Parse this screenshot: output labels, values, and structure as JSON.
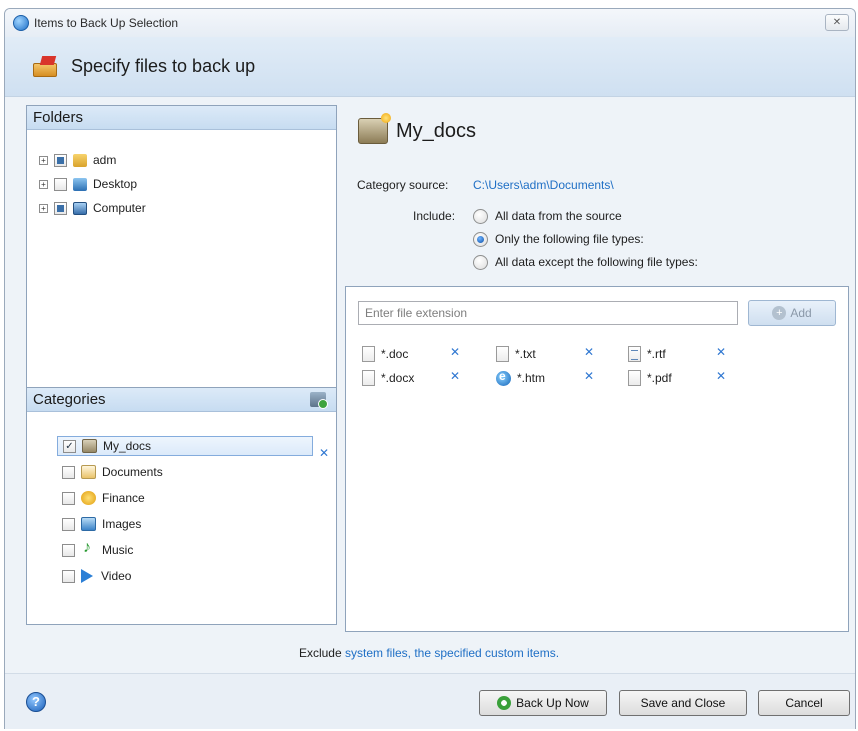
{
  "window": {
    "title": "Items to Back Up Selection",
    "close_glyph": "✕"
  },
  "header": {
    "title": "Specify files to back up"
  },
  "folders": {
    "heading": "Folders",
    "items": [
      {
        "label": "adm",
        "checked": "partial",
        "icon": "user-folder-icon"
      },
      {
        "label": "Desktop",
        "checked": "none",
        "icon": "desktop-icon"
      },
      {
        "label": "Computer",
        "checked": "partial",
        "icon": "computer-icon"
      }
    ]
  },
  "categories": {
    "heading": "Categories",
    "items": [
      {
        "label": "My_docs",
        "checked": true,
        "selected": true
      },
      {
        "label": "Documents",
        "checked": false
      },
      {
        "label": "Finance",
        "checked": false
      },
      {
        "label": "Images",
        "checked": false
      },
      {
        "label": "Music",
        "checked": false
      },
      {
        "label": "Video",
        "checked": false
      }
    ],
    "remove_glyph": "✕"
  },
  "category_detail": {
    "name": "My_docs",
    "source_label": "Category source:",
    "source_path": "C:\\Users\\adm\\Documents\\",
    "include_label": "Include:",
    "options": [
      {
        "label": "All data from the source",
        "selected": false
      },
      {
        "label": "Only the following file types:",
        "selected": true
      },
      {
        "label": "All data except the following file types:",
        "selected": false
      }
    ]
  },
  "file_types": {
    "input_placeholder": "Enter file extension",
    "add_label": "Add",
    "remove_glyph": "✕",
    "items": [
      "*.doc",
      "*.txt",
      "*.rtf",
      "*.docx",
      "*.htm",
      "*.pdf"
    ]
  },
  "exclude": {
    "label": "Exclude",
    "link": "system files, the specified custom items."
  },
  "footer": {
    "help_glyph": "?",
    "back_up_now": "Back Up Now",
    "save_and_close": "Save and Close",
    "cancel": "Cancel"
  },
  "colors": {
    "link": "#1f6fc5",
    "panel_border": "#8fa3bb",
    "header_bg": "#cfe0f1"
  }
}
